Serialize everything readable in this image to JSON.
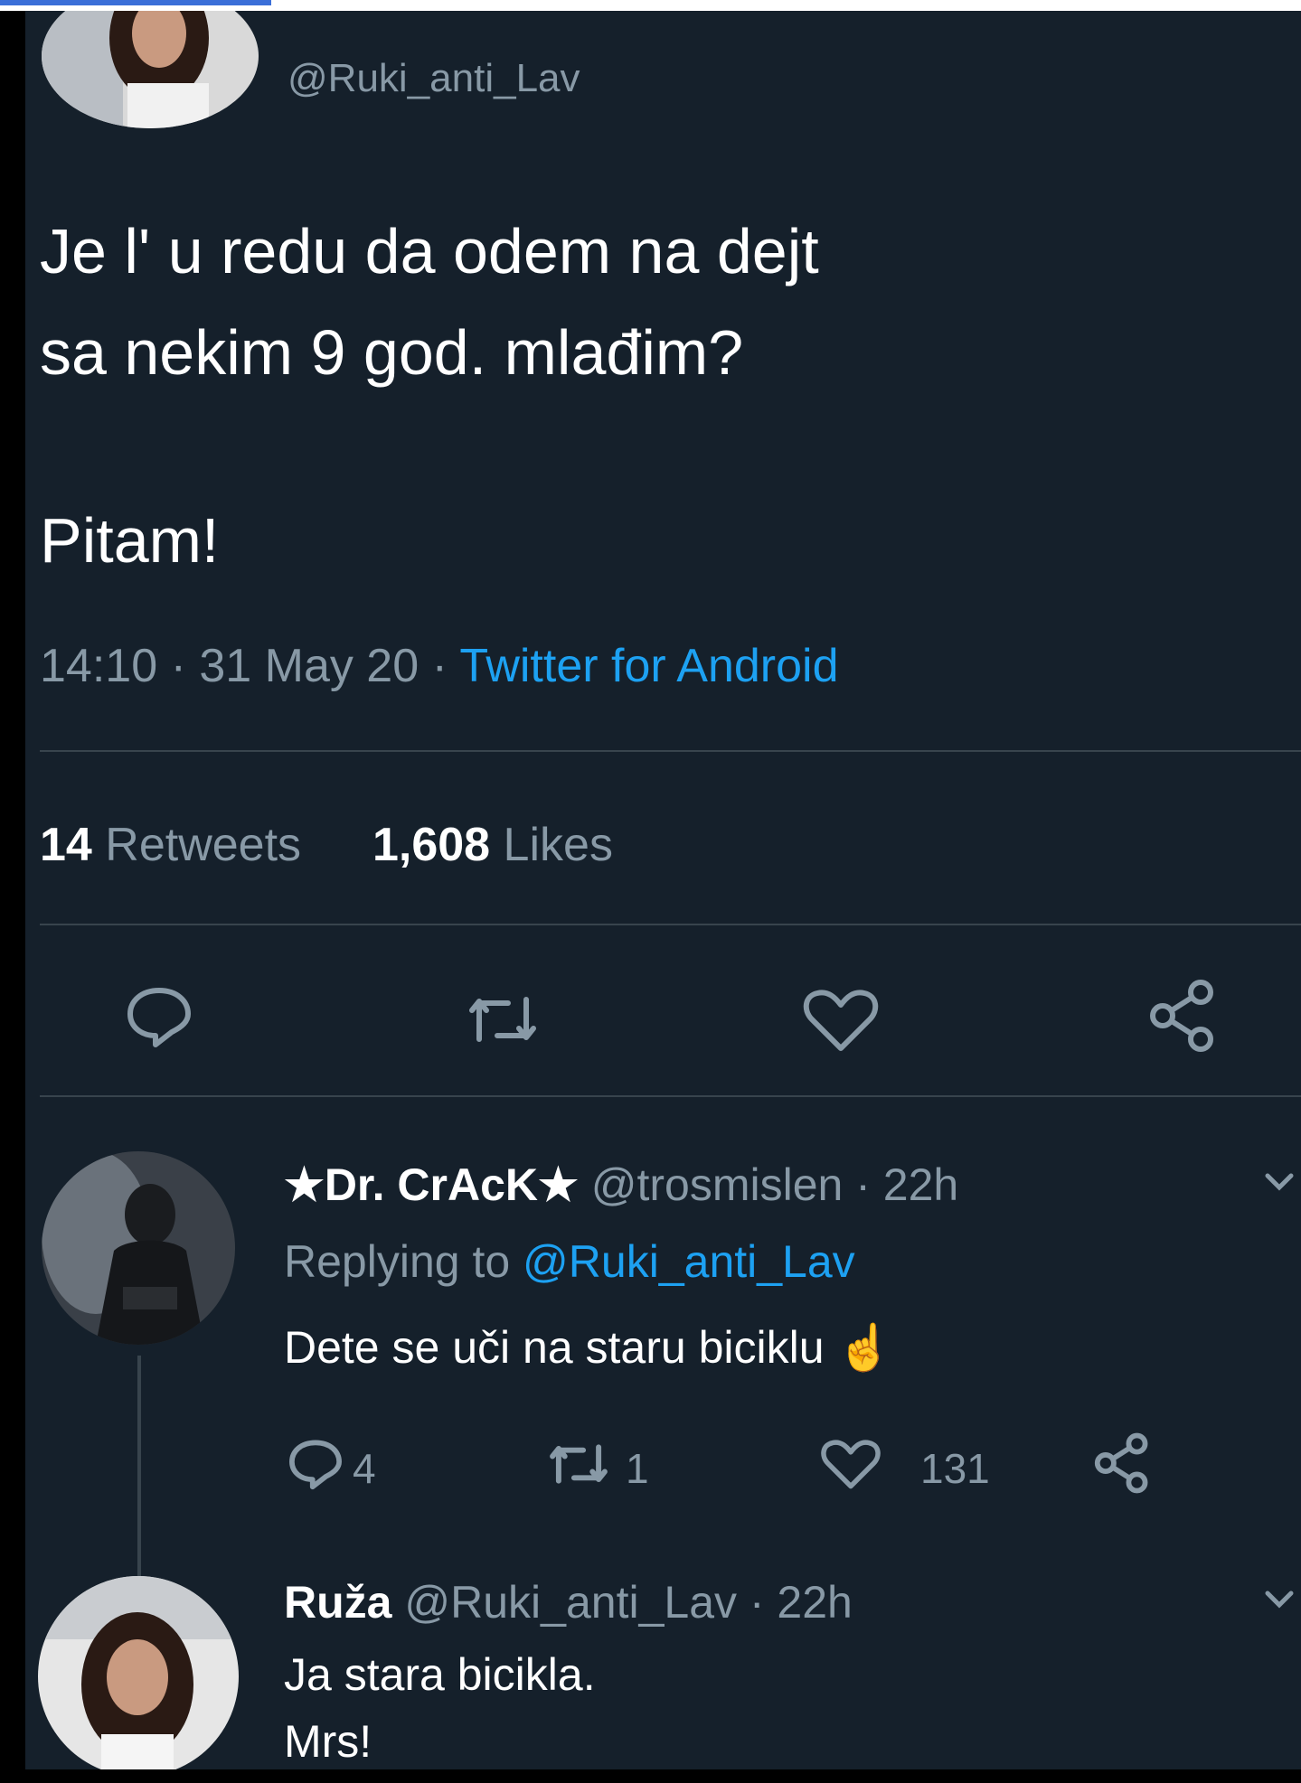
{
  "tweet": {
    "handle": "@Ruki_anti_Lav",
    "text_line1": "Je l' u redu da odem na dejt",
    "text_line2": "sa nekim 9 god. mlađim?",
    "text_line3": "Pitam!",
    "time": "14:10 · 31 May 20 · ",
    "source": "Twitter for Android",
    "retweets_count": "14",
    "retweets_label": " Retweets",
    "likes_count": "1,608",
    "likes_label": " Likes"
  },
  "reply1": {
    "name": "★Dr. CrAcK★",
    "handle_time": "@trosmislen · 22h",
    "replying_label": "Replying to ",
    "replying_handle": "@Ruki_anti_Lav",
    "text": "Dete se uči na staru biciklu ☝",
    "reply_count": "4",
    "retweet_count": "1",
    "like_count": "131"
  },
  "reply2": {
    "name": "Ruža",
    "handle_time": "@Ruki_anti_Lav · 22h",
    "text_line1": "Ja stara bicikla.",
    "text_line2": "Mrs!"
  },
  "icons": {
    "reply": "comment-icon",
    "retweet": "retweet-icon",
    "like": "heart-icon",
    "share": "share-icon",
    "caret": "chevron-down-icon"
  },
  "colors": {
    "background": "#15202b",
    "text": "#ffffff",
    "secondary": "#8899a6",
    "link": "#1da1f2",
    "divider": "#38444d"
  }
}
